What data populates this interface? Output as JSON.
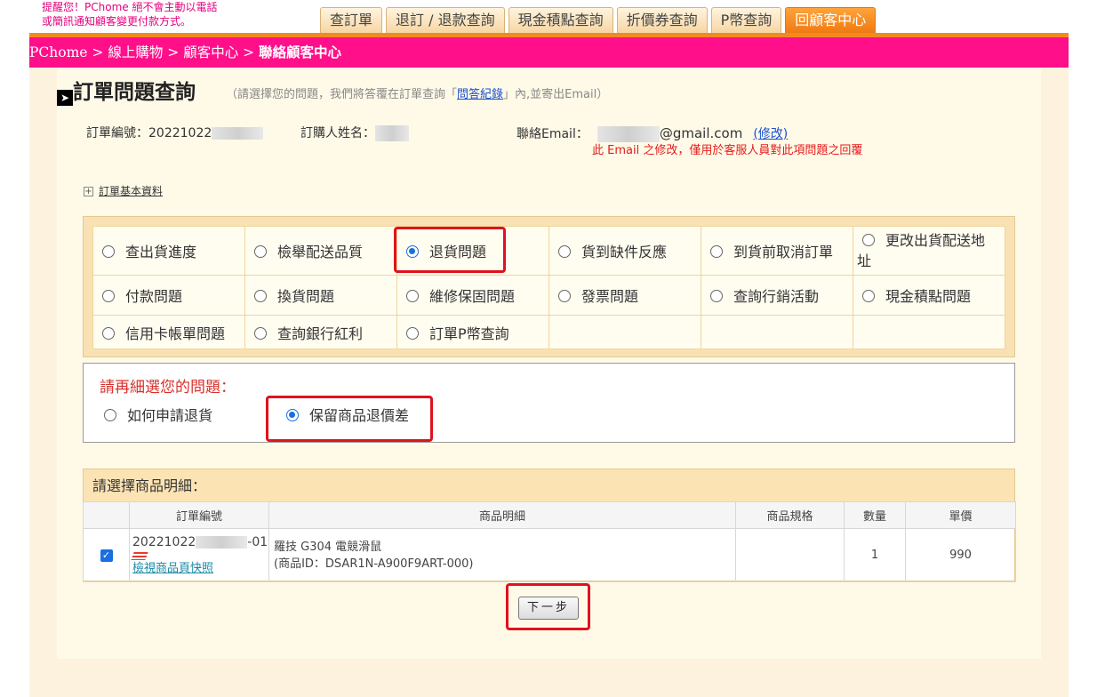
{
  "notice": {
    "line1": "提醒您！PChome 絕不會主動以電話",
    "line2": "或簡訊通知顧客變更付款方式。"
  },
  "tabs": [
    {
      "label": "查訂單",
      "active": false
    },
    {
      "label": "退訂 / 退款查詢",
      "active": false
    },
    {
      "label": "現金積點查詢",
      "active": false
    },
    {
      "label": "折價券查詢",
      "active": false
    },
    {
      "label": "P幣查詢",
      "active": false
    },
    {
      "label": "回顧客中心",
      "active": true
    }
  ],
  "breadcrumb": {
    "home": "PChome",
    "sep": " > ",
    "level1": "線上購物",
    "level2": "顧客中心",
    "current": "聯絡顧客中心"
  },
  "heading": {
    "arrow": "➤",
    "title": "訂單問題查詢",
    "hint_prefix": "（請選擇您的問題，我們將答覆在訂單查詢「",
    "hint_link": "問答紀錄",
    "hint_suffix": "」內,並寄出Email）"
  },
  "order_info": {
    "order_no_label": "訂單編號：",
    "order_no_value": "20221022",
    "buyer_label": "訂購人姓名：",
    "email_label": "聯絡Email：",
    "email_domain": "@gmail.com",
    "edit_label": "(修改)",
    "email_note": "此 Email 之修改，僅用於客服人員對此項問題之回覆"
  },
  "basic_info_toggle": {
    "icon": "+",
    "label": "訂單基本資料"
  },
  "question_rows": [
    [
      {
        "label": "查出貨進度",
        "selected": false
      },
      {
        "label": "檢舉配送品質",
        "selected": false
      },
      {
        "label": "退貨問題",
        "selected": true
      },
      {
        "label": "貨到缺件反應",
        "selected": false
      },
      {
        "label": "到貨前取消訂單",
        "selected": false
      },
      {
        "label": "更改出貨配送地址",
        "selected": false
      }
    ],
    [
      {
        "label": "付款問題",
        "selected": false
      },
      {
        "label": "換貨問題",
        "selected": false
      },
      {
        "label": "維修保固問題",
        "selected": false
      },
      {
        "label": "發票問題",
        "selected": false
      },
      {
        "label": "查詢行銷活動",
        "selected": false
      },
      {
        "label": "現金積點問題",
        "selected": false
      }
    ],
    [
      {
        "label": "信用卡帳單問題",
        "selected": false
      },
      {
        "label": "查詢銀行紅利",
        "selected": false
      },
      {
        "label": "訂單P幣查詢",
        "selected": false
      }
    ]
  ],
  "sub_question": {
    "title": "請再細選您的問題：",
    "options": [
      {
        "label": "如何申請退貨",
        "selected": false
      },
      {
        "label": "保留商品退價差",
        "selected": true
      }
    ]
  },
  "product_section": {
    "title": "請選擇商品明細：",
    "columns": [
      "",
      "訂單編號",
      "商品明細",
      "商品規格",
      "數量",
      "單價"
    ],
    "rows": [
      {
        "checked": true,
        "order_no_prefix": "20221022",
        "order_no_suffix": "-01",
        "view_link": "檢視商品頁快照",
        "product_name": "羅技 G304 電競滑鼠",
        "product_id": "(商品ID：DSAR1N-A900F9ART-000)",
        "spec": "",
        "qty": "1",
        "price": "990"
      }
    ]
  },
  "next_button": "下一步",
  "colors": {
    "brand_pink": "#ff0f8a",
    "brand_orange": "#f38a1e",
    "highlight_red": "#e0121e",
    "radio_blue": "#1a6fe0"
  }
}
